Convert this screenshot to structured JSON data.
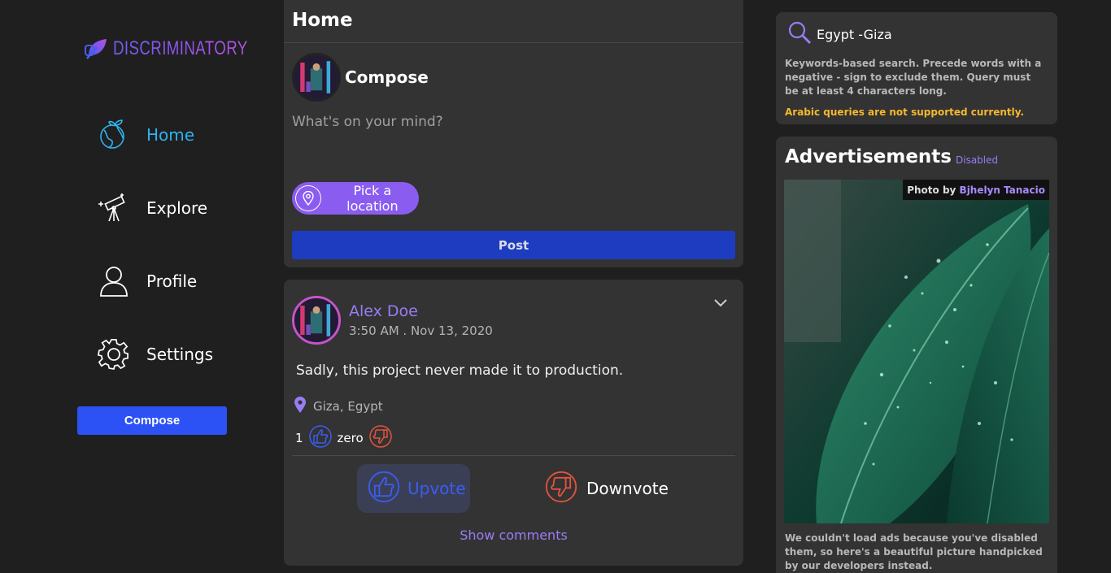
{
  "brand": {
    "name": "DISCRIMINATORY",
    "logo_icon": "leaf-logo-icon"
  },
  "sidebar": {
    "items": [
      {
        "label": "Home",
        "icon": "globe-plant-icon",
        "active": true
      },
      {
        "label": "Explore",
        "icon": "telescope-icon",
        "active": false
      },
      {
        "label": "Profile",
        "icon": "user-icon",
        "active": false
      },
      {
        "label": "Settings",
        "icon": "gear-icon",
        "active": false
      }
    ],
    "compose_label": "Compose"
  },
  "home": {
    "title": "Home",
    "compose_label": "Compose",
    "compose_placeholder": "What's on your mind?",
    "location_button": "Pick a location",
    "post_button": "Post"
  },
  "post": {
    "author": "Alex Doe",
    "time": "3:50 AM . Nov 13, 2020",
    "text": "Sadly, this project never made it to production.",
    "location": "Giza, Egypt",
    "upvotes": "1",
    "downvotes": "zero",
    "upvote_label": "Upvote",
    "downvote_label": "Downvote",
    "show_comments": "Show comments"
  },
  "search": {
    "value": "Egypt -Giza",
    "help": "Keywords-based search. Precede words with a negative - sign to exclude them. Query must be at least 4 characters long.",
    "warning": "Arabic queries are not supported currently."
  },
  "ads": {
    "title": "Advertisements",
    "status": "Disabled",
    "credit_prefix": "Photo by",
    "credit_name": "Bjhelyn Tanacio",
    "note": "We couldn't load ads because you've disabled them, so here's a beautiful picture handpicked by our developers instead."
  },
  "colors": {
    "accent_purple": "#9a7cf5",
    "active_blue": "#2eb3f0",
    "primary_button": "#2c52f5",
    "post_button": "#1e3cbf",
    "warning": "#f5b82e",
    "downvote_red": "#e5533d"
  }
}
